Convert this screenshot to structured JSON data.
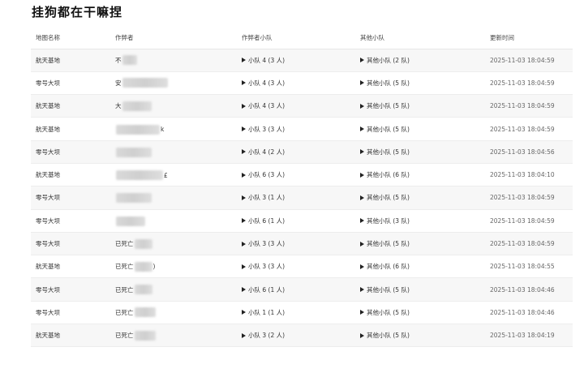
{
  "page": {
    "title": "挂狗都在干嘛捏"
  },
  "table": {
    "headers": {
      "map": "地图名称",
      "author": "作弊者",
      "squad": "作弊者小队",
      "other": "其他小队",
      "time": "更新时间"
    },
    "rows": [
      {
        "map": "航天基地",
        "author_prefix": "不",
        "author_suffix": "",
        "squad": "小队 4 (3 人)",
        "other": "其他小队 (2 队)",
        "time": "2025-11-03 18:04:59",
        "blur_w": 18
      },
      {
        "map": "零号大坝",
        "author_prefix": "安",
        "author_suffix": "",
        "squad": "小队 4 (3 人)",
        "other": "其他小队 (5 队)",
        "time": "2025-11-03 18:04:59",
        "blur_w": 56
      },
      {
        "map": "航天基地",
        "author_prefix": "大",
        "author_suffix": "",
        "squad": "小队 4 (3 人)",
        "other": "其他小队 (5 队)",
        "time": "2025-11-03 18:04:59",
        "blur_w": 36
      },
      {
        "map": "航天基地",
        "author_prefix": "",
        "author_suffix": "k",
        "squad": "小队 3 (3 人)",
        "other": "其他小队 (5 队)",
        "time": "2025-11-03 18:04:59",
        "blur_w": 54
      },
      {
        "map": "零号大坝",
        "author_prefix": "",
        "author_suffix": "",
        "squad": "小队 4 (2 人)",
        "other": "其他小队 (5 队)",
        "time": "2025-11-03 18:04:56",
        "blur_w": 44
      },
      {
        "map": "航天基地",
        "author_prefix": "",
        "author_suffix": "£",
        "squad": "小队 6 (3 人)",
        "other": "其他小队 (6 队)",
        "time": "2025-11-03 18:04:10",
        "blur_w": 58
      },
      {
        "map": "零号大坝",
        "author_prefix": "",
        "author_suffix": "",
        "squad": "小队 3 (1 人)",
        "other": "其他小队 (5 队)",
        "time": "2025-11-03 18:04:59",
        "blur_w": 44
      },
      {
        "map": "零号大坝",
        "author_prefix": "",
        "author_suffix": "",
        "squad": "小队 6 (1 人)",
        "other": "其他小队 (3 队)",
        "time": "2025-11-03 18:04:59",
        "blur_w": 36
      },
      {
        "map": "零号大坝",
        "author_prefix": "已死亡",
        "author_suffix": "",
        "squad": "小队 3 (3 人)",
        "other": "其他小队 (5 队)",
        "time": "2025-11-03 18:04:59",
        "blur_w": 22
      },
      {
        "map": "航天基地",
        "author_prefix": "已死亡",
        "author_suffix": ")",
        "squad": "小队 3 (3 人)",
        "other": "其他小队 (6 队)",
        "time": "2025-11-03 18:04:55",
        "blur_w": 22
      },
      {
        "map": "零号大坝",
        "author_prefix": "已死亡",
        "author_suffix": "",
        "squad": "小队 6 (1 人)",
        "other": "其他小队 (5 队)",
        "time": "2025-11-03 18:04:46",
        "blur_w": 22
      },
      {
        "map": "零号大坝",
        "author_prefix": "已死亡",
        "author_suffix": "",
        "squad": "小队 1 (1 人)",
        "other": "其他小队 (5 队)",
        "time": "2025-11-03 18:04:46",
        "blur_w": 26
      },
      {
        "map": "航天基地",
        "author_prefix": "已死亡",
        "author_suffix": "",
        "squad": "小队 3 (2 人)",
        "other": "其他小队 (5 队)",
        "time": "2025-11-03 18:04:19",
        "blur_w": 26
      }
    ]
  }
}
